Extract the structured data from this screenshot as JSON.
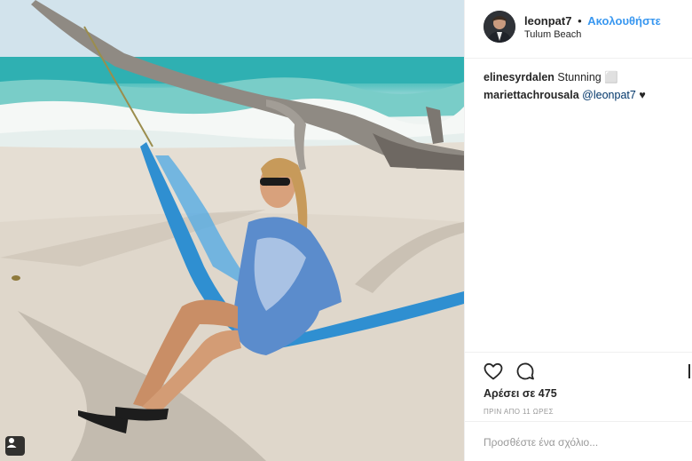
{
  "header": {
    "username": "leonpat7",
    "separator": "•",
    "follow_label": "Ακολουθήστε",
    "location": "Tulum Beach"
  },
  "comments": [
    {
      "user": "elinesyrdalen",
      "text": "Stunning ⬜"
    },
    {
      "user": "mariettachrousala",
      "mention": "@leonpat7",
      "text": "♥"
    }
  ],
  "likes_text": "Αρέσει σε 475",
  "time_text": "ΠΡΙΝ ΑΠΟ 11 ΩΡΕΣ",
  "add_comment": {
    "placeholder": "Προσθέστε ένα σχόλιο..."
  },
  "icons": {
    "like": "heart-icon",
    "comment": "comment-bubble-icon",
    "photo_tag": "user-tag-icon"
  },
  "colors": {
    "follow": "#3897f0",
    "text": "#262626",
    "muted": "#999999",
    "border": "#efefef"
  }
}
